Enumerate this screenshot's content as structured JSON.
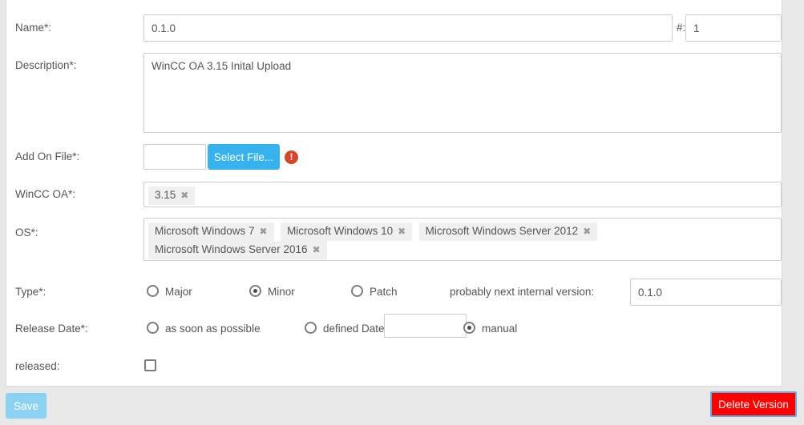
{
  "form": {
    "fields": {
      "name": {
        "label": "Name*:",
        "value": "0.1.0",
        "placeholder": ""
      },
      "number": {
        "label": "#:",
        "value": "1",
        "placeholder": ""
      },
      "description": {
        "label": "Description*:",
        "value": "WinCC OA 3.15 Inital Upload",
        "placeholder": ""
      },
      "addon_file": {
        "label": "Add On File*:",
        "value": "",
        "placeholder": "",
        "button_label": "Select File...",
        "error_icon_glyph": "!",
        "error_icon_color": "#d9452a"
      },
      "wincc_oa": {
        "label": "WinCC OA*:",
        "tags": [
          "3.15"
        ],
        "remove_glyph": "✖"
      },
      "os": {
        "label": "OS*:",
        "tags": [
          "Microsoft Windows 7",
          "Microsoft Windows 10",
          "Microsoft Windows Server 2012",
          "Microsoft Windows Server 2016"
        ],
        "remove_glyph": "✖"
      },
      "type": {
        "label": "Type*:",
        "options": [
          "Major",
          "Minor",
          "Patch"
        ],
        "selected": "Minor",
        "next_version_label": "probably next internal version:",
        "next_version_value": "0.1.0"
      },
      "release_date": {
        "label": "Release Date*:",
        "options": [
          "as soon as possible",
          "defined Date",
          "manual"
        ],
        "selected": "manual",
        "date_value": "",
        "date_placeholder": ""
      },
      "released": {
        "label": "released:",
        "checked": false
      }
    }
  },
  "footer": {
    "save_label": "Save",
    "delete_label": "Delete Version"
  },
  "scrollbar": {
    "up_glyph": "▲",
    "down_glyph": "▼"
  },
  "colors": {
    "accent": "#36b3ef",
    "danger": "#ff0000",
    "error": "#d9452a",
    "save_disabled": "#8bd2f2"
  }
}
